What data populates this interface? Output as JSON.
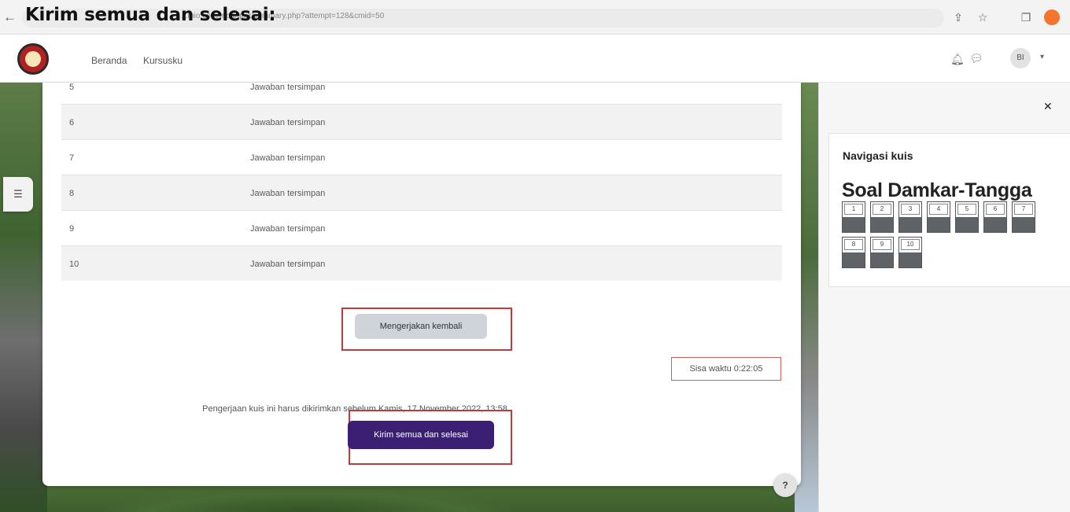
{
  "caption": "Kirim semua dan selesai:",
  "browser": {
    "url": "...mio.com/mod/quiz/summary.php?attempt=128&cmid=50"
  },
  "nav": {
    "links": [
      "Beranda",
      "Kursusku"
    ],
    "avatar_initials": "BI"
  },
  "summary": {
    "rows": [
      {
        "number": "5",
        "status": "Jawaban tersimpan"
      },
      {
        "number": "6",
        "status": "Jawaban tersimpan"
      },
      {
        "number": "7",
        "status": "Jawaban tersimpan"
      },
      {
        "number": "8",
        "status": "Jawaban tersimpan"
      },
      {
        "number": "9",
        "status": "Jawaban tersimpan"
      },
      {
        "number": "10",
        "status": "Jawaban tersimpan"
      }
    ],
    "return_button": "Mengerjakan kembali",
    "timer": "Sisa waktu 0:22:05",
    "deadline_text": "Pengerjaan kuis ini harus dikirimkan sebelum Kamis, 17 November 2022, 13:58",
    "submit_button": "Kirim semua dan selesai",
    "help": "?"
  },
  "quiz_navigation": {
    "title": "Navigasi kuis",
    "quiz_name": "Soal Damkar-Tangga",
    "questions": [
      "1",
      "2",
      "3",
      "4",
      "5",
      "6",
      "7",
      "8",
      "9",
      "10"
    ]
  },
  "colors": {
    "submit_button": "#3a1f73",
    "highlight_box": "#c0393b",
    "answered_fill": "#5f6368"
  }
}
